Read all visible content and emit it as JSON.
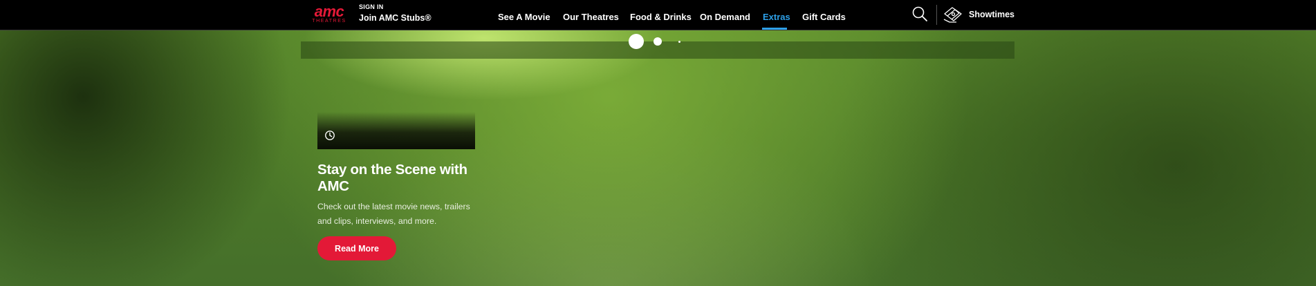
{
  "header": {
    "logo": {
      "mark": "amc",
      "sub": "THEATRES"
    },
    "account": {
      "sign_in": "SIGN IN",
      "join": "Join AMC Stubs®"
    },
    "nav": [
      {
        "label": "See A Movie"
      },
      {
        "label": "Our Theatres"
      },
      {
        "label": "Food & Drinks"
      },
      {
        "label": "On Demand"
      },
      {
        "label": "Extras",
        "active": true
      },
      {
        "label": "Gift Cards"
      }
    ],
    "search_icon": "search-icon",
    "showtimes": {
      "icon": "ticket-icon",
      "label": "Showtimes"
    }
  },
  "carousel": {
    "dots": 3,
    "active_index": 0
  },
  "feature": {
    "icon": "clock-icon",
    "title": "Stay on the Scene with AMC",
    "description": "Check out the latest movie news, trailers and clips, interviews, and more.",
    "cta": "Read More"
  },
  "colors": {
    "brand_red": "#e31937",
    "active_nav": "#2da0e8",
    "navbar_bg": "#000000"
  }
}
